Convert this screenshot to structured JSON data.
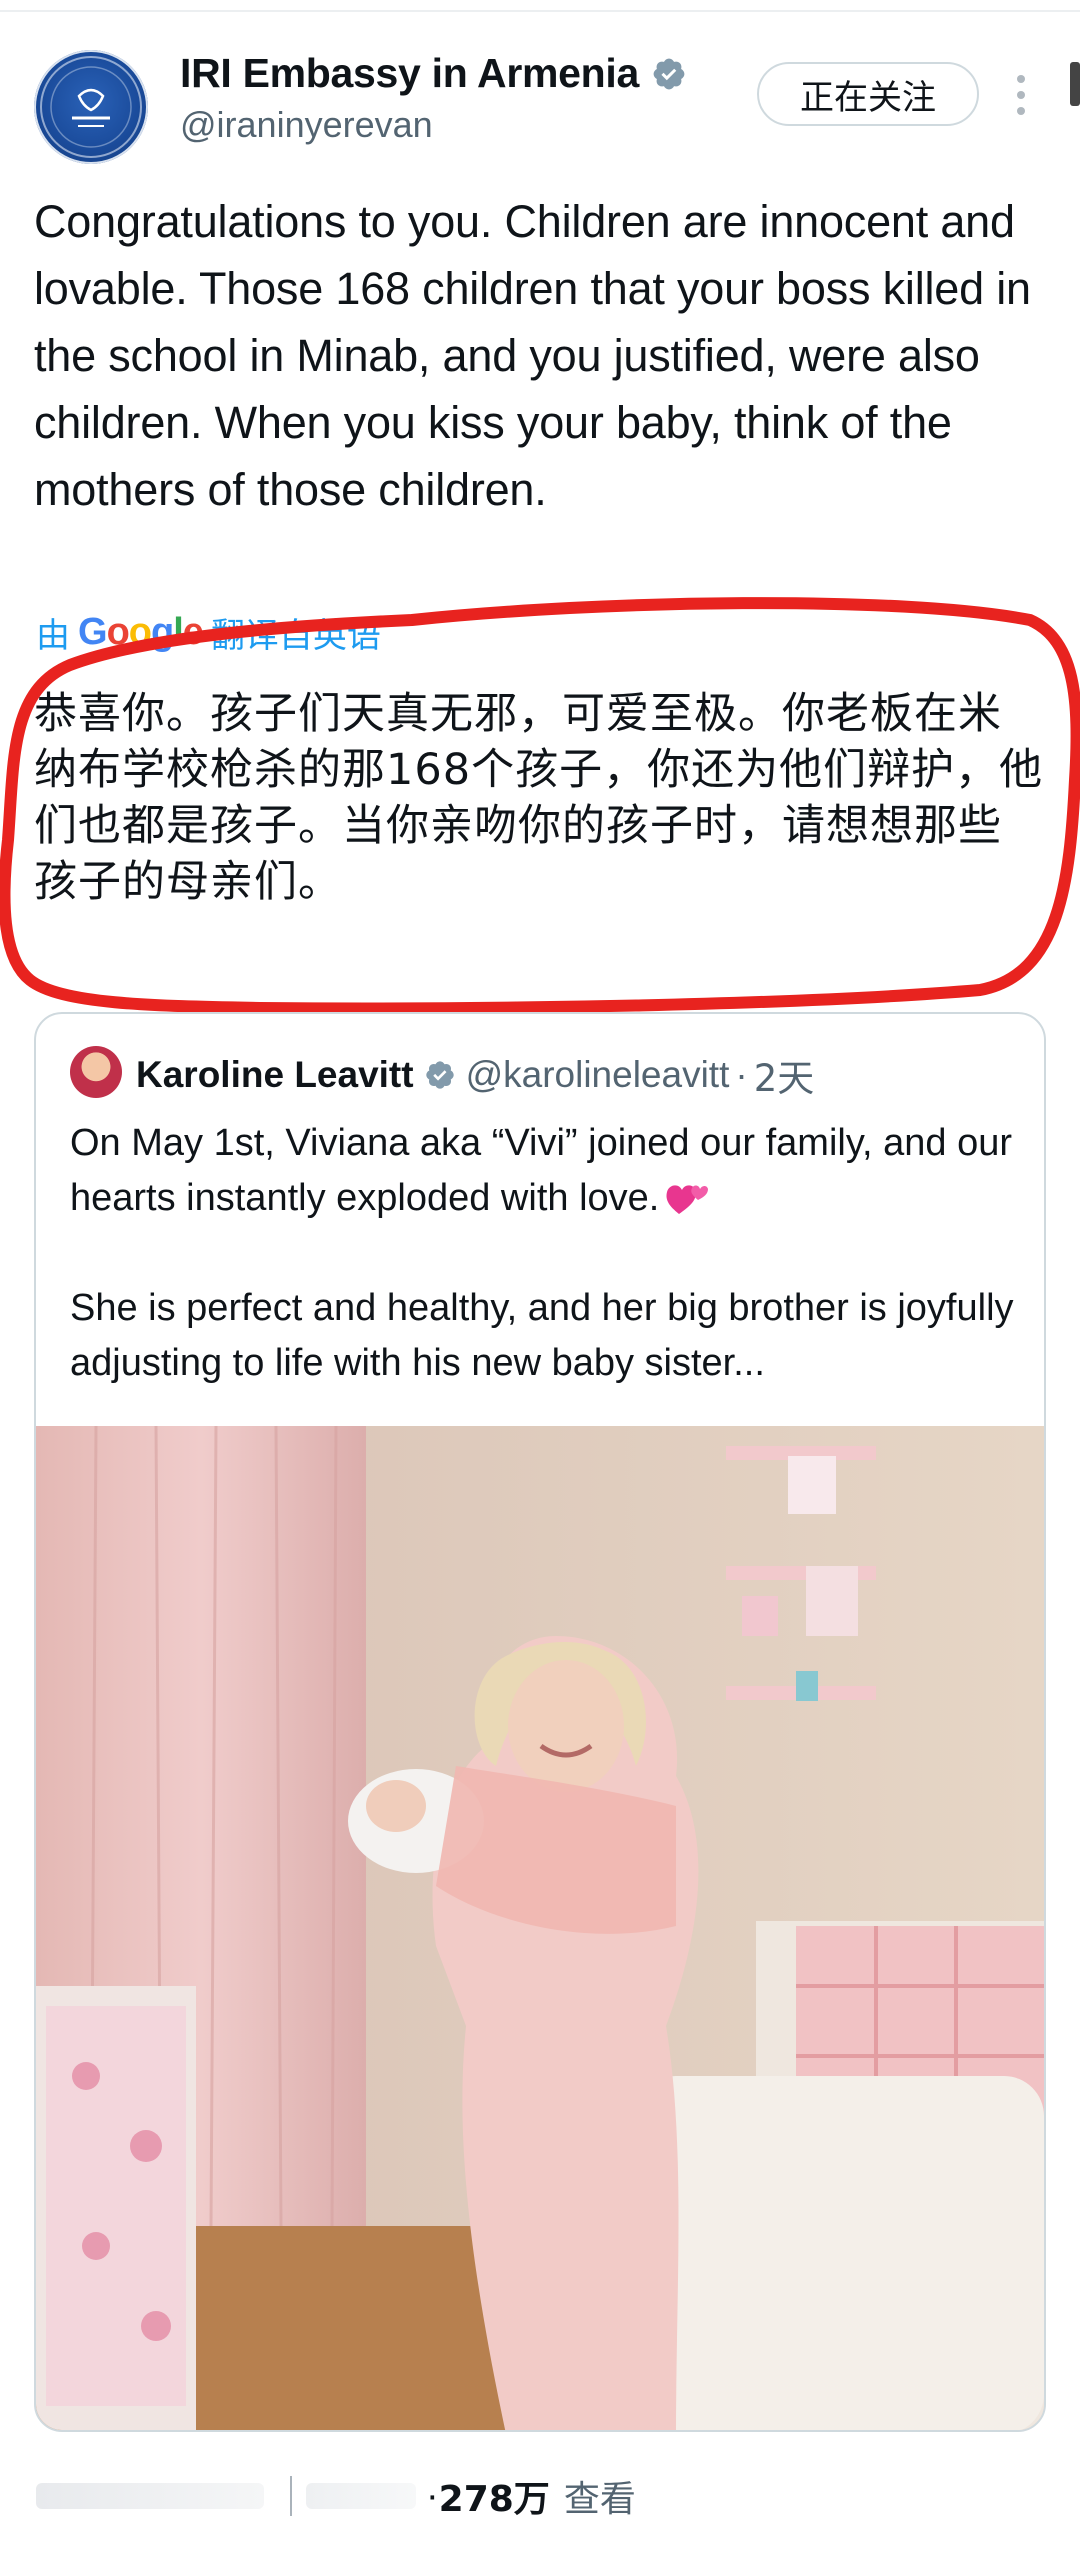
{
  "post": {
    "display_name": "IRI Embassy in Armenia",
    "handle": "@iraninyerevan",
    "follow_button_label": "正在关注",
    "text": "Congratulations to you. Children are innocent and lovable. Those 168 children that your boss killed in the school in Minab, and you justified, were also children. When you kiss your baby, think of the mothers of those children.",
    "translation_prefix": "由",
    "translation_provider": "Google",
    "translation_suffix": "翻译自英语",
    "translated_text": "恭喜你。孩子们天真无邪，可爱至极。你老板在米纳布学校枪杀的那168个孩子，你还为他们辩护，他们也都是孩子。当你亲吻你的孩子时，请想想那些孩子的母亲们。"
  },
  "quoted_post": {
    "display_name": "Karoline Leavitt",
    "handle": "@karolineleavitt",
    "separator": "·",
    "age": "2天",
    "paragraph_1": "On May 1st, Viviana aka “Vivi” joined our family, and our hearts instantly exploded with love.",
    "paragraph_2": "She is perfect and healthy, and her big brother is joyfully adjusting to life with his new baby sister..."
  },
  "footer": {
    "views_separator": "·",
    "views_count": "278万",
    "views_link": "查看"
  },
  "colors": {
    "accent_blue": "#1d9bf0",
    "verified_gray": "#829aab",
    "annotation_red": "#e8231f",
    "secondary_text": "#536471"
  }
}
